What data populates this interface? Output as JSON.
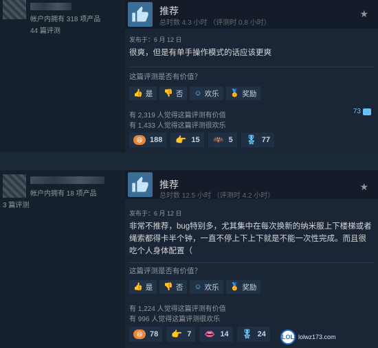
{
  "reviews": [
    {
      "products_owned": "帐户内拥有 318 项产品",
      "review_count": "44 篇评测",
      "verdict": "推荐",
      "hours": "总时数 4.3 小时 （评测时 0.8 小时）",
      "posted": "发布于：6 月 12 日",
      "body": "很爽，但是有单手操作模式的话应该更爽",
      "helpful_question": "这篇评测是否有价值？",
      "buttons": {
        "yes": "是",
        "no": "否",
        "funny": "欢乐",
        "award": "奖励"
      },
      "helpful_stat": "有 2,319 人觉得这篇评测有价值",
      "funny_stat": "有 1,433 人觉得这篇评测很欢乐",
      "comments": "73",
      "awards": [
        {
          "icon": "laugh-face-icon",
          "count": "188"
        },
        {
          "icon": "pointing-hand-icon",
          "count": "15"
        },
        {
          "icon": "winged-icon",
          "count": "5"
        },
        {
          "icon": "medal-icon",
          "count": "77"
        }
      ]
    },
    {
      "products_owned": "帐户内拥有 18 项产品",
      "review_count": "3 篇评测",
      "verdict": "推荐",
      "hours": "总时数 12.5 小时 （评测时 4.2 小时）",
      "posted": "发布于：6 月 12 日",
      "body": "非常不推荐，bug特别多，尤其集中在每次换新的纳米服上下楼梯或者绳索都得卡半个钟，一直不停上下上下就是不能一次性完成。而且很吃个人身体配置（",
      "helpful_question": "这篇评测是否有价值？",
      "buttons": {
        "yes": "是",
        "no": "否",
        "funny": "欢乐",
        "award": "奖励"
      },
      "helpful_stat": "有 1,224 人觉得这篇评测有价值",
      "funny_stat": "有 996 人觉得这篇评测很欢乐",
      "awards": [
        {
          "icon": "laugh-face-icon",
          "count": "78"
        },
        {
          "icon": "pointing-hand-icon",
          "count": "7"
        },
        {
          "icon": "lips-icon",
          "count": "14"
        },
        {
          "icon": "medal-icon",
          "count": "24"
        }
      ]
    }
  ],
  "watermark": {
    "circle": "LOL",
    "text": "lolwz173.com"
  },
  "colors": {
    "background": "#1b2838",
    "accent": "#67c1f5",
    "award_gold": "#d2a22a"
  }
}
